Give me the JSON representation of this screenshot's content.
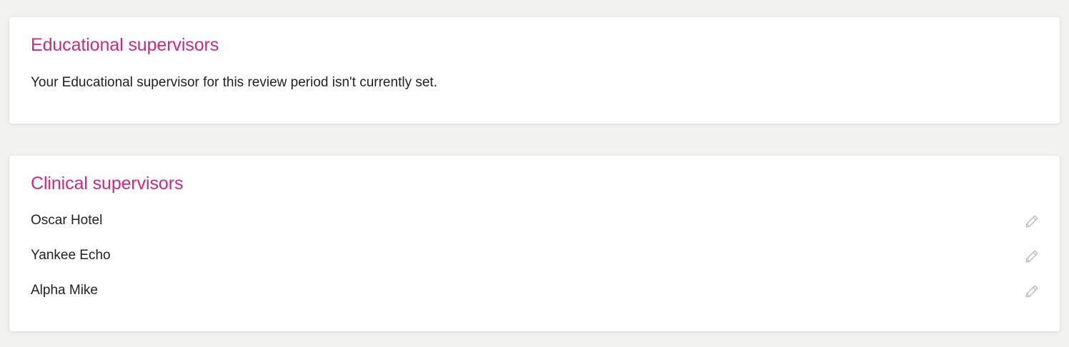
{
  "educational": {
    "title": "Educational supervisors",
    "message": "Your Educational supervisor for this review period isn't currently set."
  },
  "clinical": {
    "title": "Clinical supervisors",
    "supervisors": [
      {
        "name": "Oscar Hotel",
        "action_icon": "pencil-icon"
      },
      {
        "name": "Yankee Echo",
        "action_icon": "pencil-icon"
      },
      {
        "name": "Alpha Mike",
        "action_icon": "pencil-icon"
      }
    ]
  },
  "colors": {
    "accent": "#cc2a82",
    "background": "#f2f2f1",
    "card": "#ffffff",
    "text": "#222222",
    "icon": "#bdbdbd"
  }
}
